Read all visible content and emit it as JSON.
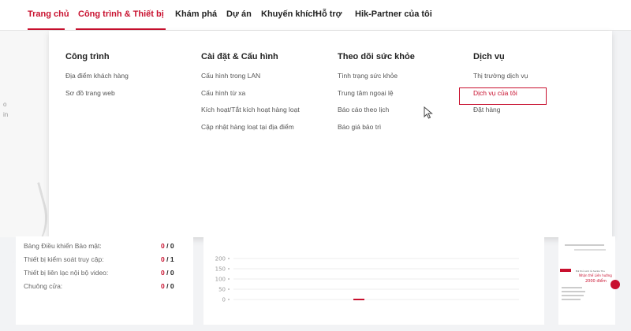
{
  "nav": {
    "tabs": [
      {
        "label": "Trang chủ"
      },
      {
        "label": "Công trình & Thiết bị"
      },
      {
        "label": "Khám phá"
      },
      {
        "label": "Dự án"
      },
      {
        "label": "Khuyến khích"
      },
      {
        "label": "Hỗ trợ"
      },
      {
        "label": "Hik-Partner của tôi"
      }
    ]
  },
  "menu": {
    "columns": [
      {
        "title": "Công trình",
        "items": [
          "Địa điểm khách hàng",
          "Sơ đồ trang web"
        ]
      },
      {
        "title": "Cài đặt & Cấu hình",
        "items": [
          "Cấu hình trong LAN",
          "Cấu hình từ xa",
          "Kích hoạt/Tắt kích hoạt hàng loạt",
          "Cập nhật hàng loạt tại địa điểm"
        ]
      },
      {
        "title": "Theo dõi sức khỏe",
        "items": [
          "Tình trạng sức khỏe",
          "Trung tâm ngoại lệ",
          "Báo cáo theo lịch",
          "Báo giá bảo trì"
        ]
      },
      {
        "title": "Dịch vụ",
        "items": [
          "Thị trường dịch vụ",
          "Dịch vụ của tôi",
          "Đặt hàng"
        ]
      }
    ]
  },
  "left_fragments": [
    "o",
    "in"
  ],
  "stats": [
    {
      "label": "Bảng Điều khiển Bảo mật:",
      "online": "0",
      "total": "0"
    },
    {
      "label": "Thiết bị kiểm soát truy cập:",
      "online": "0",
      "total": "1"
    },
    {
      "label": "Thiết bị liên lạc nội bộ video:",
      "online": "0",
      "total": "0"
    },
    {
      "label": "Chuông cửa:",
      "online": "0",
      "total": "0"
    }
  ],
  "chart_data": {
    "type": "line",
    "y_ticks": [
      "200",
      "150",
      "100",
      "50",
      "0"
    ],
    "ylim": [
      0,
      200
    ],
    "values": [
      0
    ]
  },
  "ad": {
    "line1": "Đã thử sinh là Santa Thu",
    "line2": "Nhận thể Liên hướng",
    "line3": "2000 điểm"
  },
  "colors": {
    "accent": "#c8102e"
  }
}
